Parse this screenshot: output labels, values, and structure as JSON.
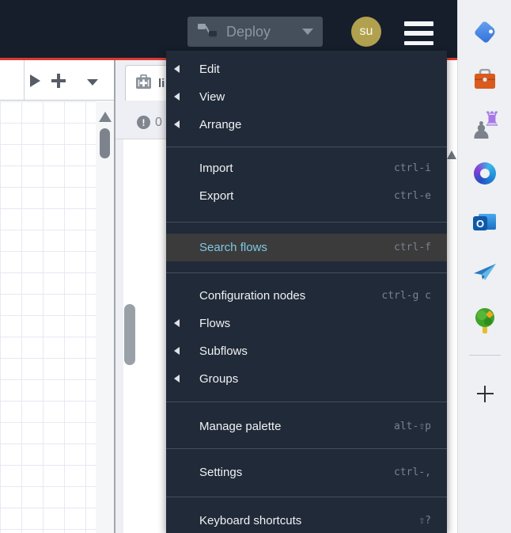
{
  "colors": {
    "accent_red": "#dc3a31",
    "header_bg": "#161e2c",
    "menu_bg": "#212a38",
    "menu_highlight_bg": "#3b3b3b",
    "menu_highlight_text": "#7fc8e6",
    "avatar_bg": "#b1a14f"
  },
  "header": {
    "deploy_label": "Deploy",
    "avatar_initials": "su"
  },
  "menu": {
    "items": [
      {
        "label": "Edit",
        "has_submenu": true
      },
      {
        "label": "View",
        "has_submenu": true
      },
      {
        "label": "Arrange",
        "has_submenu": true
      },
      {
        "label": "Import",
        "shortcut": "ctrl-i"
      },
      {
        "label": "Export",
        "shortcut": "ctrl-e"
      },
      {
        "label": "Search flows",
        "shortcut": "ctrl-f",
        "highlighted": true
      },
      {
        "label": "Configuration nodes",
        "shortcut": "ctrl-g c"
      },
      {
        "label": "Flows",
        "has_submenu": true
      },
      {
        "label": "Subflows",
        "has_submenu": true
      },
      {
        "label": "Groups",
        "has_submenu": true
      },
      {
        "label": "Manage palette",
        "shortcut": "alt-⇧p"
      },
      {
        "label": "Settings",
        "shortcut": "ctrl-,"
      },
      {
        "label": "Keyboard shortcuts",
        "shortcut": "⇧?"
      }
    ]
  },
  "workspace": {
    "panel_tab_label": "li",
    "issue_count": "0",
    "search_value": ""
  }
}
